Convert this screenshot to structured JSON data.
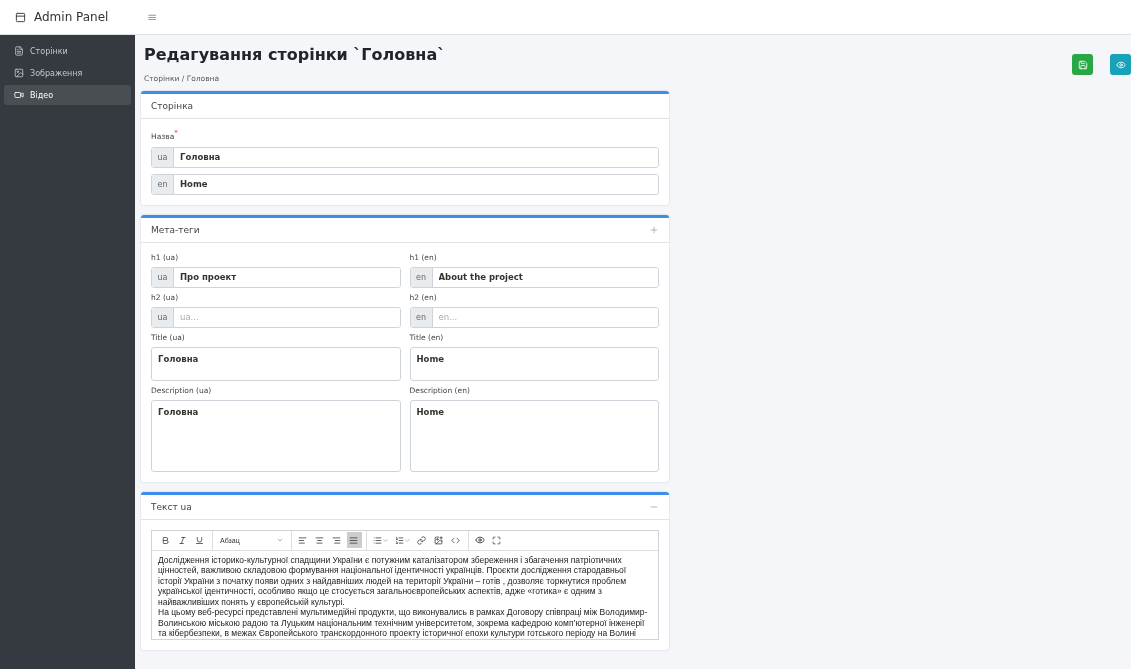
{
  "brand": "Admin Panel",
  "sidebar": {
    "items": [
      {
        "label": "Сторінки",
        "selected": false
      },
      {
        "label": "Зображення",
        "selected": false
      },
      {
        "label": "Відео",
        "selected": true
      }
    ]
  },
  "topbar": {
    "menu": "≡"
  },
  "page": {
    "title": "Редагування сторінки `Головна`",
    "breadcrumb": [
      "Сторінки",
      "Головна"
    ],
    "breadcrumb_separator": "/"
  },
  "card_page": {
    "title": "Сторінка",
    "label": "Назва",
    "required_mark": "*",
    "fields": [
      {
        "prefix": "ua",
        "value": "Головна"
      },
      {
        "prefix": "en",
        "value": "Home"
      }
    ]
  },
  "card_meta": {
    "title": "Мета-теги",
    "expanded": false,
    "fields": [
      {
        "kind": "input",
        "label": "h1 (ua)",
        "prefix": "ua",
        "value": "Про проект"
      },
      {
        "kind": "input",
        "label": "h1 (en)",
        "prefix": "en",
        "value": "About the project"
      },
      {
        "kind": "input",
        "label": "h2 (ua)",
        "prefix": "ua",
        "placeholder": "ua..."
      },
      {
        "kind": "input",
        "label": "h2 (en)",
        "prefix": "en",
        "placeholder": "en..."
      },
      {
        "kind": "short",
        "label": "Title (ua)",
        "value": "Головна"
      },
      {
        "kind": "short",
        "label": "Title (en)",
        "value": "Home"
      },
      {
        "kind": "long",
        "label": "Description (ua)",
        "value": "Головна"
      },
      {
        "kind": "long",
        "label": "Description (en)",
        "value": "Home"
      }
    ]
  },
  "card_text": {
    "title": "Текст ua",
    "expanded": true,
    "toolbar": {
      "format": "Абзац",
      "justify_selected": true
    },
    "paragraphs": [
      "Дослідження історико-культурної спадщини України є потужним каталізатором збереження і збагачення патріотичних цінностей, важливою складовою формування національної ідентичності українців. Проєкти дослідження стародавньої історії України з початку появи одних з найдавніших людей на території України – готів , дозволяє торкнутися проблем української ідентичності, особливо якщо це стосується  загальноєвропейських аспектів, адже «готика» є одним з найважливіших понять у європейській культурі.",
      "На цьому веб-ресурсі представлені мультимедійні продукти, що виконувались в рамках Договору співпраці між Володимир-Волинською міською радою та Луцьким національним технічним університетом, зокрема кафедрою комп’ютерної інженерії та кібербезпеки, в межах Європейського транскордонного проекту історичної епохи культури готського періоду на Волині"
    ]
  }
}
